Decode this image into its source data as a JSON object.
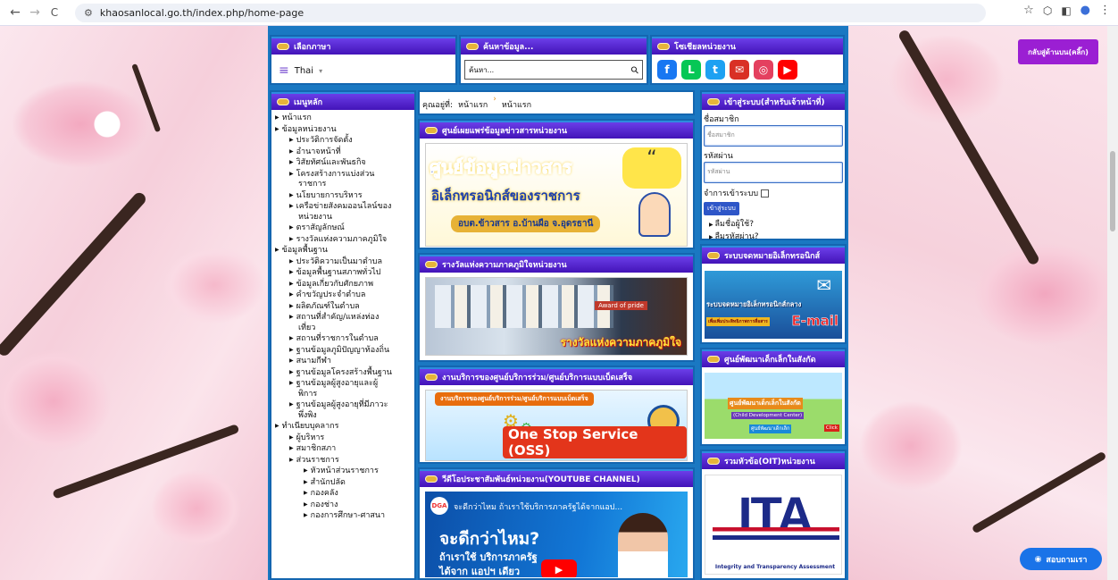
{
  "browser": {
    "url": "khaosanlocal.go.th/index.php/home-page",
    "back": "←",
    "forward": "→",
    "reload": "C",
    "star": "☆",
    "ext": "⬡",
    "panel": "◧",
    "profile": "●",
    "kebab": "⋮"
  },
  "overlay": {
    "back_label": "กลับสู่ด้านบน(คลิ๊ก)",
    "chat_label": "สอบถามเรา"
  },
  "lang": {
    "header": "เลือกภาษา",
    "value": "Thai",
    "caret": "▾",
    "menu_icon": "≡"
  },
  "search": {
    "header": "ค้นหาข้อมูล...",
    "placeholder": "ค้นหา...",
    "icon": "⚲"
  },
  "social": {
    "header": "โซเชียลหน่วยงาน",
    "items": [
      {
        "name": "facebook",
        "glyph": "f",
        "color": "#1877f2"
      },
      {
        "name": "line",
        "glyph": "L",
        "color": "#06c755"
      },
      {
        "name": "twitter",
        "glyph": "t",
        "color": "#1da1f2"
      },
      {
        "name": "email",
        "glyph": "✉",
        "color": "#d93025"
      },
      {
        "name": "instagram",
        "glyph": "◎",
        "color": "#e4405f"
      },
      {
        "name": "youtube",
        "glyph": "▶",
        "color": "#ff0000"
      }
    ]
  },
  "mainmenu": {
    "header": "เมนูหลัก",
    "items": [
      {
        "t": "หน้าแรก",
        "lv": 1
      },
      {
        "t": "ข้อมูลหน่วยงาน",
        "lv": 1
      },
      {
        "t": "ประวัติการจัดตั้ง",
        "lv": 2
      },
      {
        "t": "อำนาจหน้าที่",
        "lv": 2
      },
      {
        "t": "วิสัยทัศน์และพันธกิจ",
        "lv": 2
      },
      {
        "t": "โครงสร้างการแบ่งส่วน",
        "lv": 2
      },
      {
        "t": "ราชการ",
        "lv": 0
      },
      {
        "t": "นโยบายการบริหาร",
        "lv": 2
      },
      {
        "t": "เครือข่ายสังคมออนไลน์ของ",
        "lv": 2
      },
      {
        "t": "หน่วยงาน",
        "lv": 0
      },
      {
        "t": "ตราสัญลักษณ์",
        "lv": 2
      },
      {
        "t": "รางวัลแห่งความภาคภูมิใจ",
        "lv": 2
      },
      {
        "t": "ข้อมูลพื้นฐาน",
        "lv": 1
      },
      {
        "t": "ประวัติความเป็นมาตำบล",
        "lv": 2
      },
      {
        "t": "ข้อมูลพื้นฐานสภาพทั่วไป",
        "lv": 2
      },
      {
        "t": "ข้อมูลเกี่ยวกับศักยภาพ",
        "lv": 2
      },
      {
        "t": "คำขวัญประจำตำบล",
        "lv": 2
      },
      {
        "t": "ผลิตภัณฑ์ในตำบล",
        "lv": 2
      },
      {
        "t": "สถานที่สำคัญ/แหล่งท่อง",
        "lv": 2
      },
      {
        "t": "เที่ยว",
        "lv": 0
      },
      {
        "t": "สถานที่ราชการในตำบล",
        "lv": 2
      },
      {
        "t": "ฐานข้อมูลภูมิปัญญาท้องถิ่น",
        "lv": 2
      },
      {
        "t": "สนามกีฬา",
        "lv": 2
      },
      {
        "t": "ฐานข้อมูลโครงสร้างพื้นฐาน",
        "lv": 2
      },
      {
        "t": "ฐานข้อมูลผู้สูงอายุและผู้",
        "lv": 2
      },
      {
        "t": "พิการ",
        "lv": 0
      },
      {
        "t": "ฐานข้อมูลผู้สูงอายุที่มีภาวะ",
        "lv": 2
      },
      {
        "t": "พึ่งพิง",
        "lv": 0
      },
      {
        "t": "ทำเนียบบุคลากร",
        "lv": 1
      },
      {
        "t": "ผู้บริหาร",
        "lv": 2
      },
      {
        "t": "สมาชิกสภา",
        "lv": 2
      },
      {
        "t": "ส่วนราชการ",
        "lv": 2
      },
      {
        "t": "หัวหน้าส่วนราชการ",
        "lv": 3
      },
      {
        "t": "สำนักปลัด",
        "lv": 3
      },
      {
        "t": "กองคลัง",
        "lv": 3
      },
      {
        "t": "กองช่าง",
        "lv": 3
      },
      {
        "t": "กองการศึกษา-ศาสนา",
        "lv": 3
      }
    ]
  },
  "breadcrumb": {
    "label": "คุณอยู่ที่:",
    "a": "หน้าแรก",
    "sep": "›",
    "b": "หน้าแรก"
  },
  "center": {
    "info": {
      "header": "ศูนย์เผยแพร่ข้อมูลข่าวสารหน่วยงาน",
      "line1": "ศูนย์ข้อมูลข่าวสาร",
      "line2": "อิเล็กทรอนิกส์ของราชการ",
      "line3": "อบต.ข้าวสาร อ.บ้านผือ จ.อุดรธานี",
      "quote": "“"
    },
    "award": {
      "header": "รางวัลแห่งความภาคภูมิใจหน่วยงาน",
      "caption": "รางวัลแห่งความภาคภูมิใจ",
      "tag": "Award of pride"
    },
    "oss": {
      "header": "งานบริการของศูนย์บริการร่วม/ศูนย์บริการแบบเบ็ดเสร็จ",
      "top": "งานบริการของศูนย์บริการร่วม/ศูนย์บริการแบบเบ็ดเสร็จ",
      "title": "One Stop Service (OSS)"
    },
    "video": {
      "header": "วีดีโอประชาสัมพันธ์หน่วยงาน(YOUTUBE CHANNEL)",
      "logo": "DGA",
      "title": "จะดีกว่าไหม ถ้าเราใช้บริการภาครัฐได้จากแอป...",
      "big": "จะดีกว่าไหม?",
      "sub1": "ถ้าเราใช้ บริการภาครัฐ",
      "sub2": "ได้จาก แอปฯ เดียว"
    }
  },
  "login": {
    "header": "เข้าสู่ระบบ(สำหรับเจ้าหน้าที่)",
    "user_label": "ชื่อสมาชิก",
    "user_ph": "ชื่อสมาชิก",
    "pass_label": "รหัสผ่าน",
    "pass_ph": "รหัสผ่าน",
    "remember": "จำการเข้าระบบ",
    "submit": "เข้าสู่ระบบ",
    "forgot_user": "ลืมชื่อผู้ใช้?",
    "forgot_pass": "ลืมรหัสผ่าน?"
  },
  "right": {
    "email": {
      "header": "ระบบจดหมายอิเล็กทรอนิกส์",
      "line1": "ระบบจดหมายอิเล็กทรอนิกส์กลาง",
      "line2": "เพื่อเพิ่มประสิทธิภาพการสื่อสาร",
      "brand": "E-mail"
    },
    "child": {
      "header": "ศูนย์พัฒนาเด็กเล็กในสังกัด",
      "line1": "ศูนย์พัฒนาเด็กเล็กในสังกัด",
      "line2": "(Child Development Center)",
      "line3": "ศูนย์พัฒนาเด็กเล็ก",
      "click": "Click"
    },
    "oit": {
      "header": "รวมหัวข้อ(OIT)หน่วยงาน",
      "logo": "ITA",
      "caption": "Integrity and Transparency Assessment"
    }
  }
}
